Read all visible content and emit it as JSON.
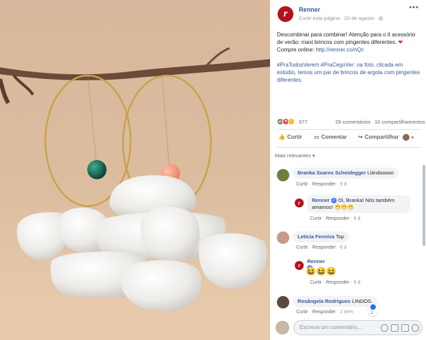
{
  "post": {
    "page_name": "Renner",
    "follow_label": "Curtir esta página",
    "date": "20 de agosto",
    "separator": "·",
    "menu_glyph": "•••",
    "text_line1": "Descombinar para combinar! Atenção para o it acessório de verão: maxi brincos com pingentes diferentes. ",
    "text_line1b": " Compre online: ",
    "link": "http://renner.co/nQc",
    "text_line2": "#PraTodosVerem #PraCegoVer: na foto, clicada em estúdio, temos um par de brincos de argola com pingentes diferentes."
  },
  "stats": {
    "reactions_count": "677",
    "comments_count": "29 comentários",
    "shares_count": "10 compartilhamentos"
  },
  "actions": {
    "like": "Curtir",
    "comment": "Comentar",
    "share": "Compartilhar"
  },
  "comments_sort": "Mais relevantes ▾",
  "comments": [
    {
      "author": "Branka Soares Scheidegger",
      "text": " Liiindooooo",
      "like": "Curtir",
      "reply": "Responder",
      "time": "9 d"
    },
    {
      "author": "Renner",
      "text": " Oi, Branka! Nós também amamos!",
      "emoji": "😁😁😁",
      "like": "Curtir",
      "reply": "Responder",
      "time": "6 d"
    },
    {
      "author": "Letícia Ferreira",
      "text": " Top",
      "like": "Curtir",
      "reply": "Responder",
      "time": "6 d"
    },
    {
      "author": "Renner",
      "emoji": "😆😆😆",
      "like": "Curtir",
      "reply": "Responder",
      "time": "6 d"
    },
    {
      "author": "Rosângela Rodrigues",
      "text": " LINDOS.",
      "like": "Curtir",
      "reply": "Responder",
      "time": "1 sem",
      "reaction_count": "1"
    }
  ],
  "composer": {
    "placeholder": "Escreva um comentário..."
  },
  "colors": {
    "brand": "#b3121c",
    "link": "#385898",
    "background_photo": "#d9b99a"
  }
}
